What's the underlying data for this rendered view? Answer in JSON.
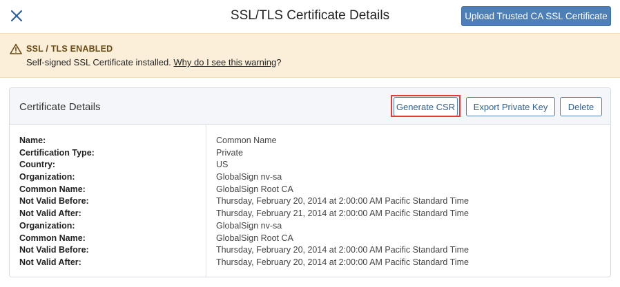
{
  "header": {
    "title": "SSL/TLS Certificate Details",
    "close_icon": "close-icon",
    "upload_button_label": "Upload Trusted CA SSL Certificate"
  },
  "warning": {
    "icon": "warning-triangle-icon",
    "title": "SSL / TLS ENABLED",
    "message_prefix": "Self-signed SSL Certificate installed. ",
    "link_text": "Why do I see this warning",
    "message_suffix": "?"
  },
  "card": {
    "title": "Certificate Details",
    "buttons": {
      "generate_csr": "Generate CSR",
      "export_private_key": "Export Private Key",
      "delete": "Delete"
    },
    "details": [
      {
        "label": "Name:",
        "value": "Common Name"
      },
      {
        "label": "Certification Type:",
        "value": "Private"
      },
      {
        "label": "Country:",
        "value": "US"
      },
      {
        "label": "Organization:",
        "value": "GlobalSign nv-sa"
      },
      {
        "label": "Common Name:",
        "value": "GlobalSign Root CA"
      },
      {
        "label": "Not Valid Before:",
        "value": "Thursday, February 20, 2014 at 2:00:00 AM Pacific Standard Time"
      },
      {
        "label": "Not Valid After:",
        "value": "Thursday, February 21, 2014 at 2:00:00 AM Pacific Standard Time"
      },
      {
        "label": "Organization:",
        "value": "GlobalSign nv-sa"
      },
      {
        "label": "Common Name:",
        "value": "GlobalSign Root CA"
      },
      {
        "label": "Not Valid Before:",
        "value": "Thursday, February 20, 2014 at 2:00:00 AM Pacific Standard Time"
      },
      {
        "label": "Not Valid After:",
        "value": "Thursday, February 20, 2014 at 2:00:00 AM Pacific Standard Time"
      }
    ]
  },
  "colors": {
    "primary": "#4e7fb7",
    "warning_bg": "#fbefd9",
    "highlight": "#e03c3c"
  }
}
